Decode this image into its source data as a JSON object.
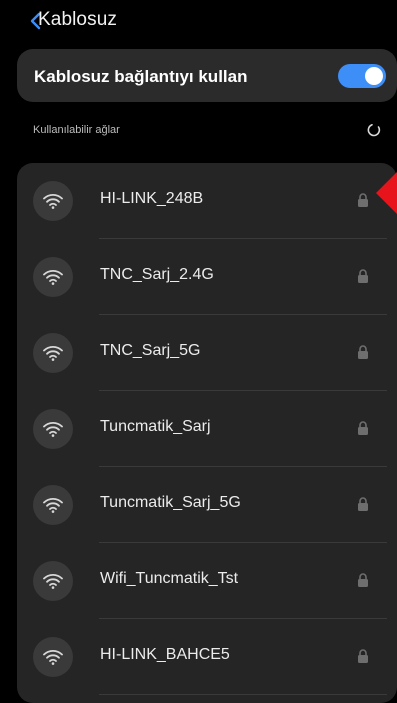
{
  "header": {
    "title": "Kablosuz"
  },
  "wifi_toggle": {
    "label": "Kablosuz bağlantıyı kullan",
    "state": "on"
  },
  "section": {
    "label": "Kullanılabilir ağlar"
  },
  "networks": [
    {
      "name": "HI-LINK_248B"
    },
    {
      "name": "TNC_Sarj_2.4G"
    },
    {
      "name": "TNC_Sarj_5G"
    },
    {
      "name": "Tuncmatik_Sarj"
    },
    {
      "name": "Tuncmatik_Sarj_5G"
    },
    {
      "name": "Wifi_Tuncmatik_Tst"
    },
    {
      "name": "HI-LINK_BAHCE5"
    }
  ],
  "colors": {
    "accent": "#3e8ef7",
    "marker": "#e8141b",
    "card": "#2b2b2b",
    "background": "#000000"
  }
}
